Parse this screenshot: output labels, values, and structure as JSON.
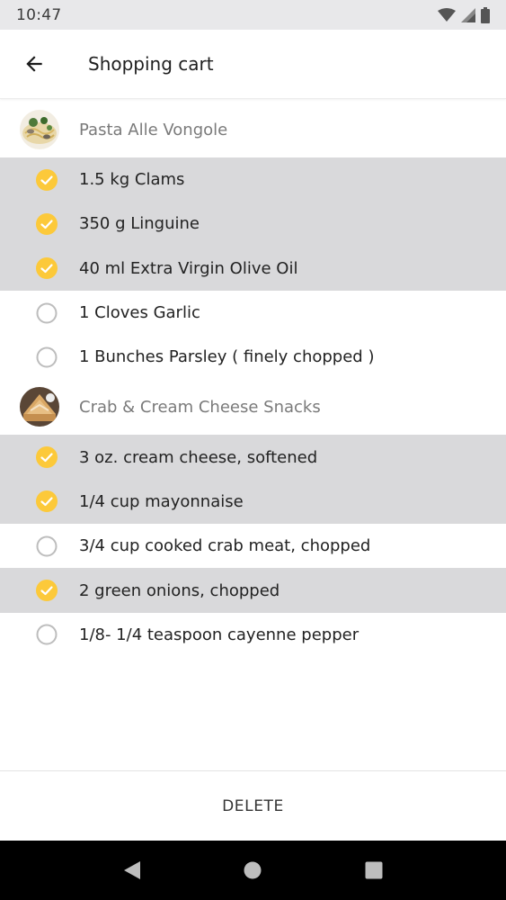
{
  "status_bar": {
    "time": "10:47"
  },
  "app_bar": {
    "title": "Shopping cart"
  },
  "recipes": [
    {
      "name": "Pasta Alle Vongole",
      "ingredients": [
        {
          "label": "1.5 kg Clams",
          "checked": true
        },
        {
          "label": "350 g Linguine",
          "checked": true
        },
        {
          "label": "40 ml Extra Virgin Olive Oil",
          "checked": true
        },
        {
          "label": "1 Cloves Garlic",
          "checked": false
        },
        {
          "label": "1 Bunches Parsley ( finely chopped )",
          "checked": false
        }
      ]
    },
    {
      "name": "Crab & Cream Cheese Snacks",
      "ingredients": [
        {
          "label": "3 oz. cream cheese, softened",
          "checked": true
        },
        {
          "label": "1/4 cup mayonnaise",
          "checked": true
        },
        {
          "label": "3/4 cup cooked crab meat, chopped",
          "checked": false
        },
        {
          "label": "2 green onions, chopped",
          "checked": true
        },
        {
          "label": "1/8- 1/4 teaspoon cayenne pepper",
          "checked": false
        }
      ]
    }
  ],
  "actions": {
    "delete_label": "DELETE"
  },
  "colors": {
    "check_yellow": "#fcc93a",
    "checked_row_bg": "#d9d9db",
    "unchecked_circle": "#bdbdbd"
  },
  "icons": {
    "back": "arrow-left-icon",
    "checked": "check-circle-icon",
    "unchecked": "empty-circle-icon",
    "nav_back": "triangle-back-icon",
    "nav_home": "circle-home-icon",
    "nav_recents": "square-recents-icon"
  }
}
